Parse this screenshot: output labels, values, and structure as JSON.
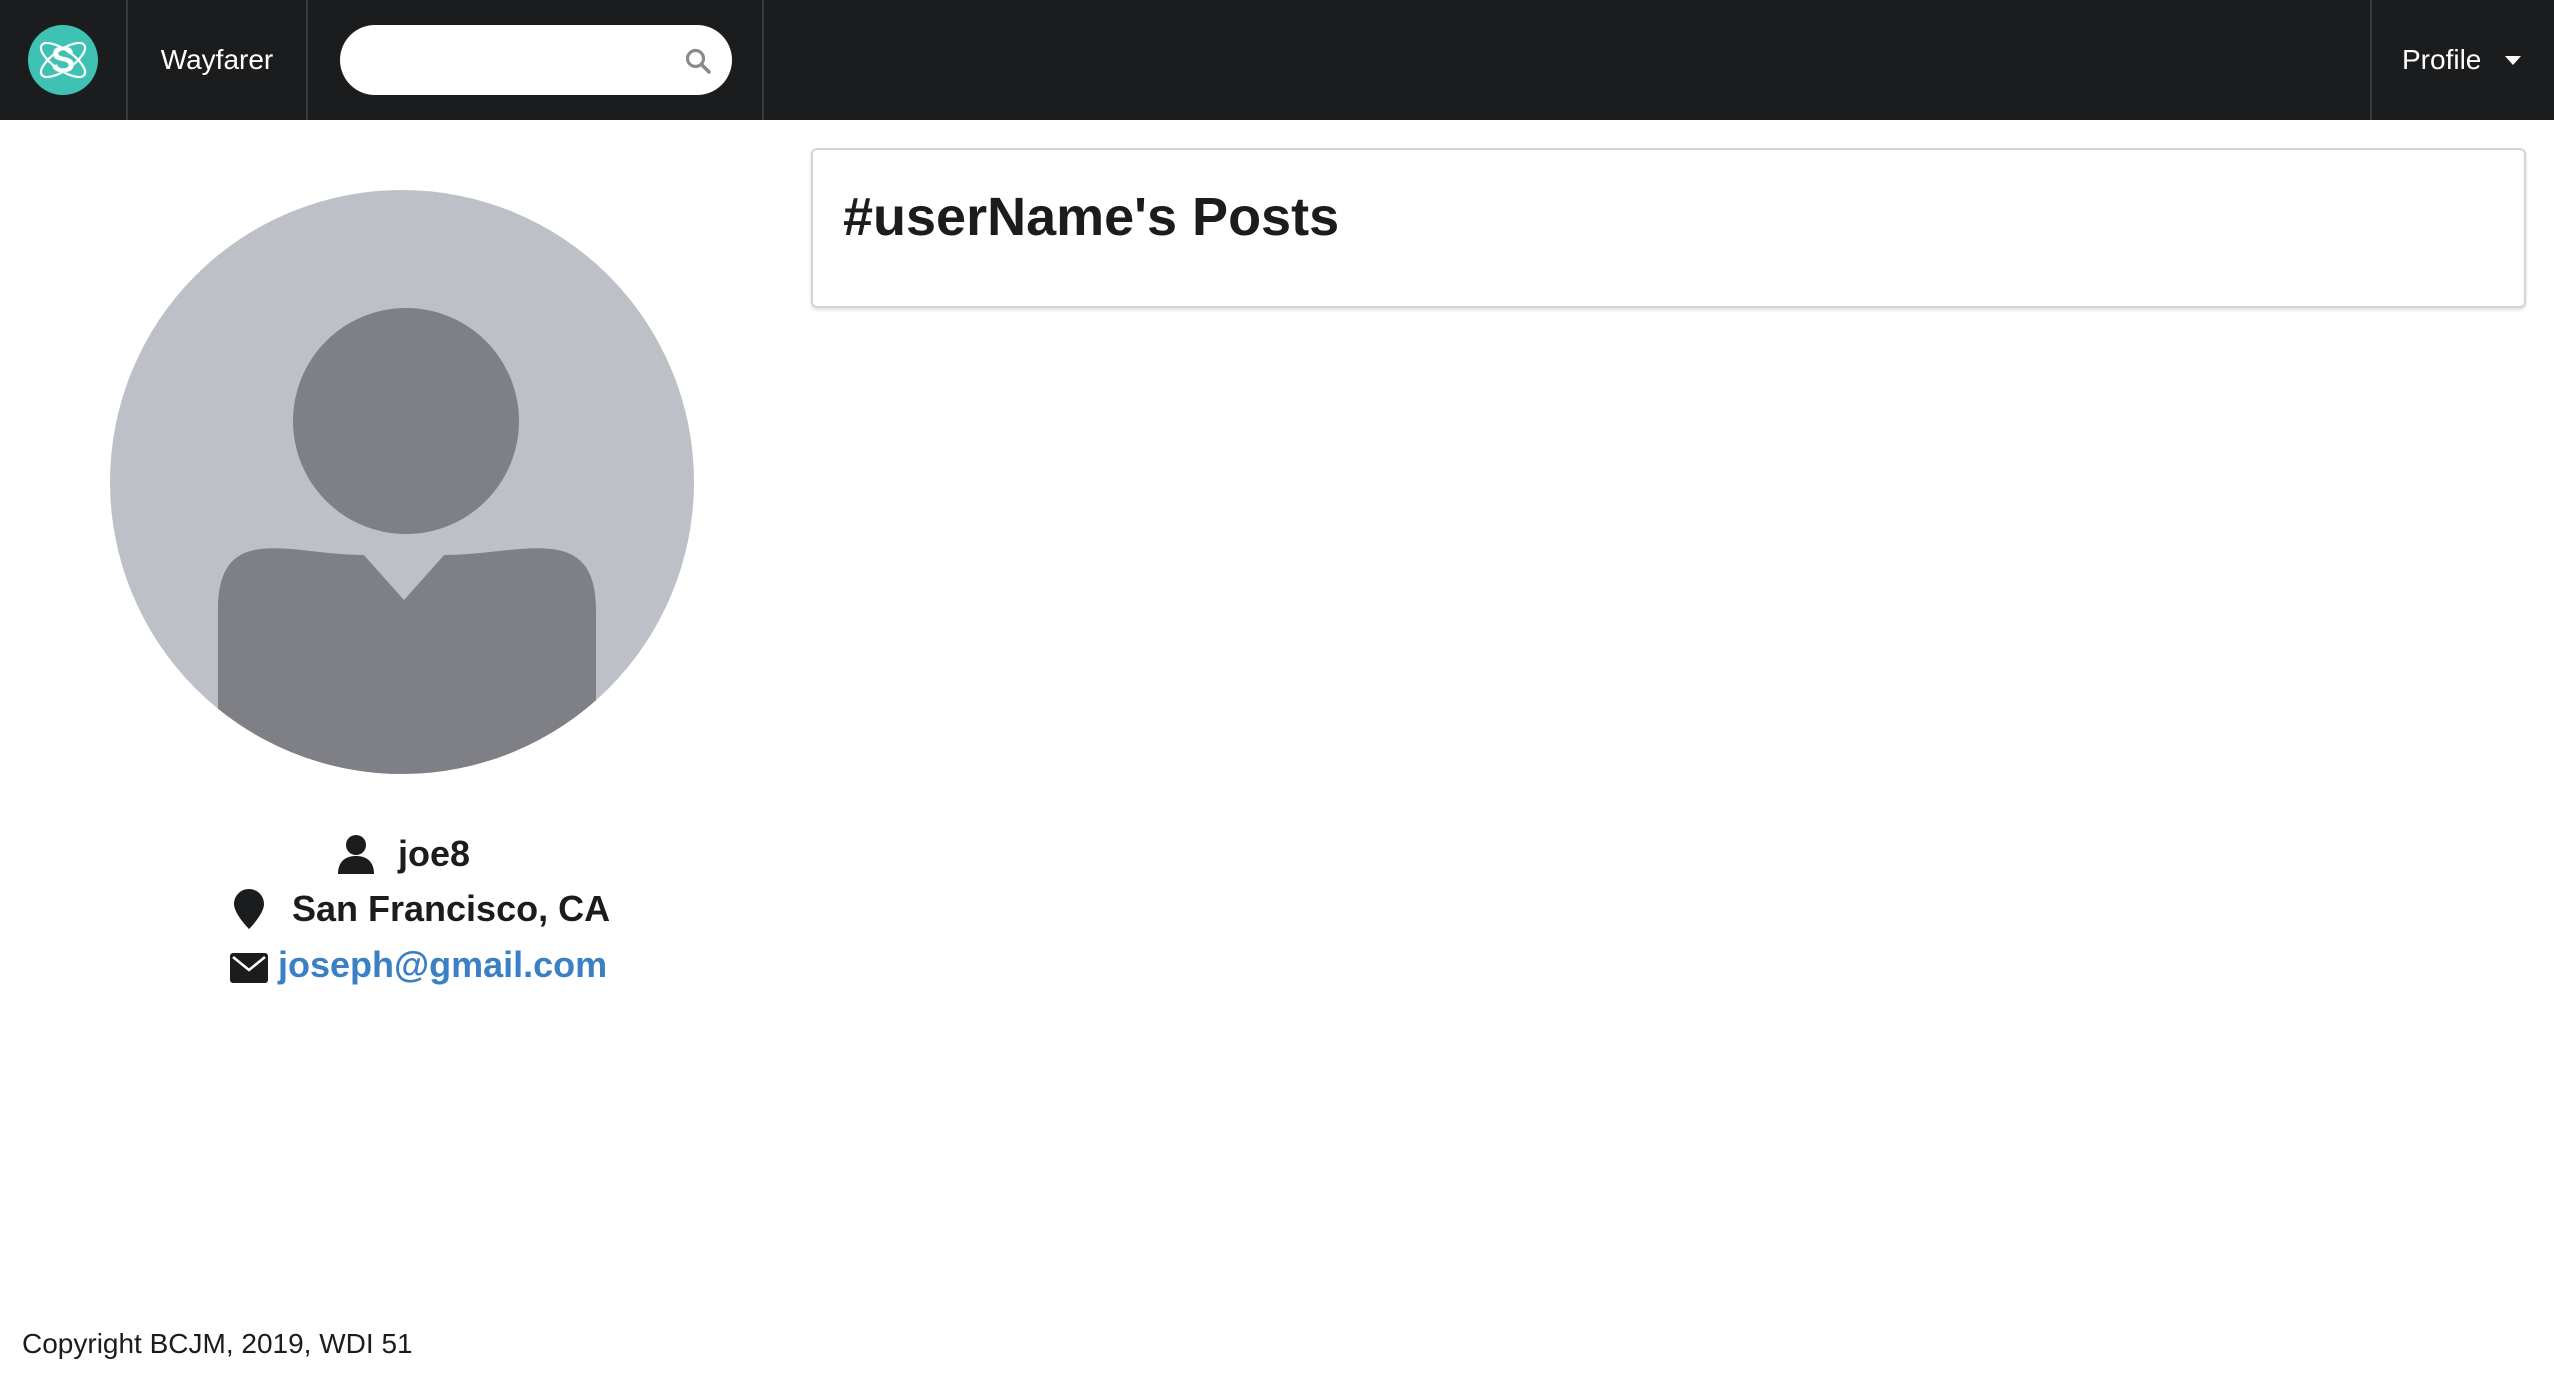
{
  "navbar": {
    "brand": "Wayfarer",
    "search": {
      "value": "",
      "placeholder": ""
    },
    "profile_label": "Profile",
    "colors": {
      "background": "#1b1c1d",
      "logo": "#3ec2b4"
    },
    "icons": [
      "semantic-logo-icon",
      "search-icon",
      "caret-down-icon"
    ]
  },
  "profile": {
    "username": "joe8",
    "location": "San Francisco, CA",
    "email": "joseph@gmail.com",
    "icons": [
      "user-icon",
      "map-marker-icon",
      "envelope-icon"
    ],
    "colors": {
      "avatar_bg": "#bec0c7",
      "avatar_figure": "#7f8085",
      "link": "#3b7fc4"
    }
  },
  "posts": {
    "title": "#userName's Posts"
  },
  "footer": {
    "copyright": "Copyright BCJM, 2019, WDI 51"
  }
}
